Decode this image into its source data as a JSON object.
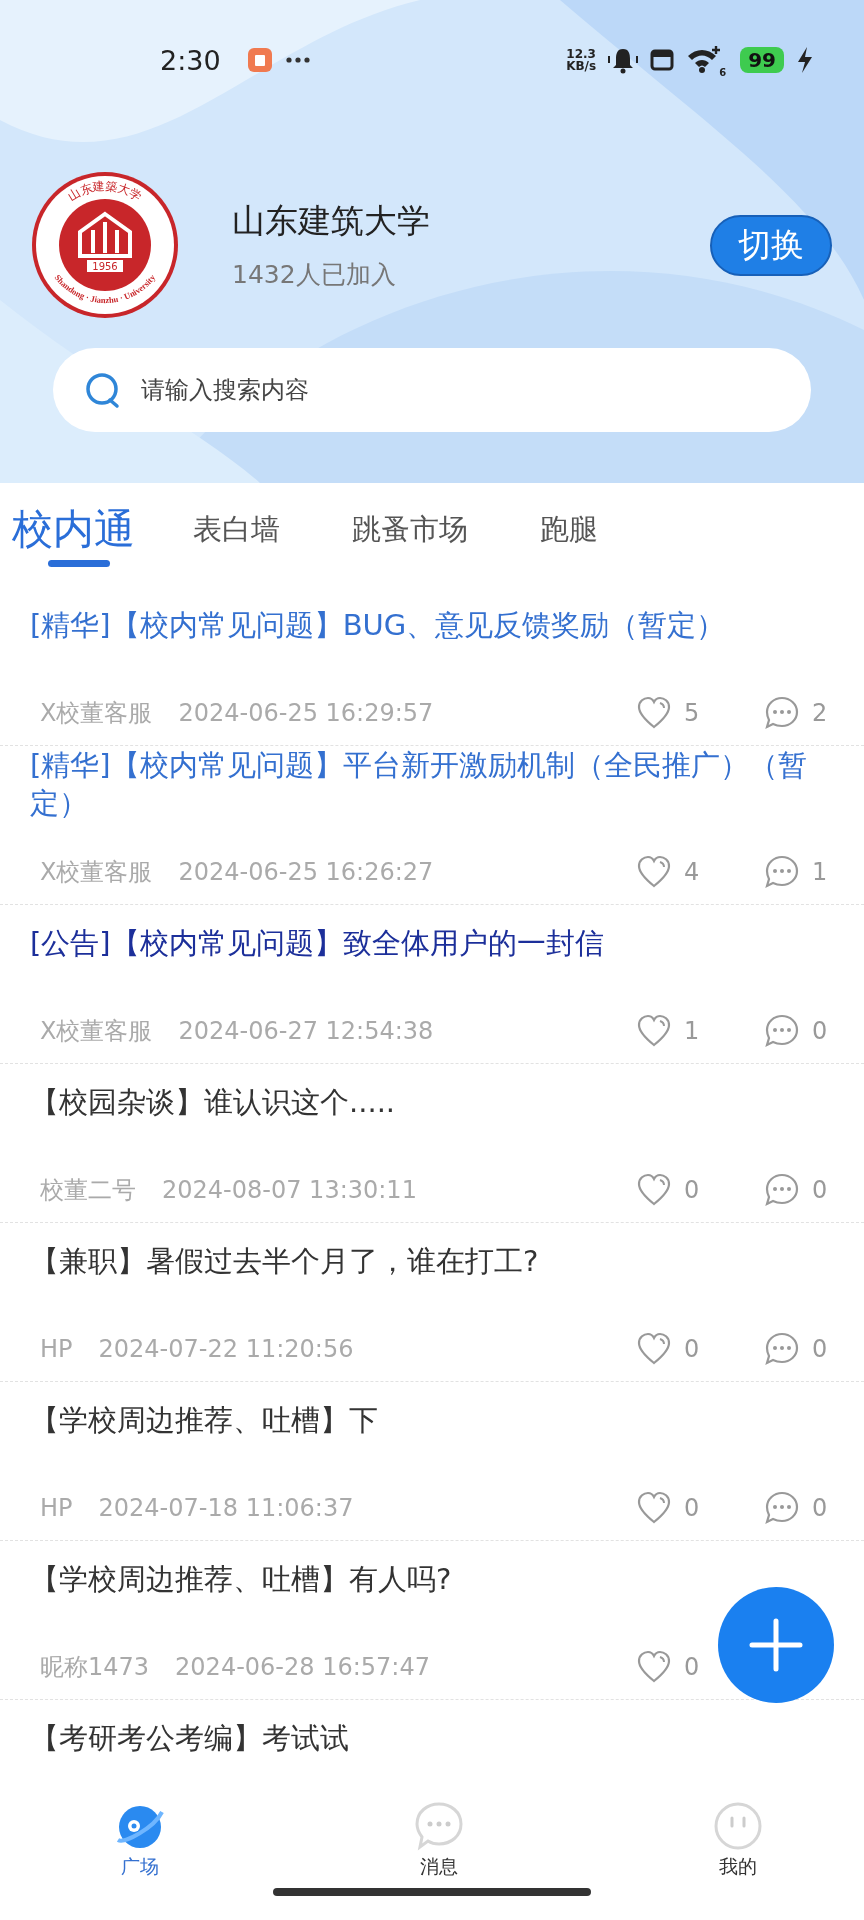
{
  "status_bar": {
    "time": "2:30",
    "net_speed_value": "12.3",
    "net_speed_unit": "KB/s",
    "wifi_badge": "6",
    "battery": "99"
  },
  "school": {
    "logo": {
      "seal_text": "山东建築大学",
      "latin_text": "Shandong · Jianzhu · University",
      "year": "1956"
    },
    "name": "山东建筑大学",
    "members": "1432人已加入",
    "switch_button": "切换"
  },
  "search": {
    "placeholder": "请输入搜索内容"
  },
  "tabs": [
    {
      "label": "校内通",
      "selected": true
    },
    {
      "label": "表白墙",
      "selected": false
    },
    {
      "label": "跳蚤市场",
      "selected": false
    },
    {
      "label": "跑腿",
      "selected": false
    }
  ],
  "posts": [
    {
      "kind": "featured",
      "title": "[精华]【校内常见问题】BUG、意见反馈奖励（暂定）",
      "author": "X校董客服",
      "time": "2024-06-25 16:29:57",
      "likes": "5",
      "comments": "2"
    },
    {
      "kind": "featured",
      "title": "[精华]【校内常见问题】平台新开激励机制（全民推广）（暂定）",
      "author": "X校董客服",
      "time": "2024-06-25 16:26:27",
      "likes": "4",
      "comments": "1"
    },
    {
      "kind": "notice",
      "title": "[公告]【校内常见问题】致全体用户的一封信",
      "author": "X校董客服",
      "time": "2024-06-27 12:54:38",
      "likes": "1",
      "comments": "0"
    },
    {
      "kind": "normal",
      "title": "【校园杂谈】谁认识这个.....",
      "author": "校董二号",
      "time": "2024-08-07 13:30:11",
      "likes": "0",
      "comments": "0"
    },
    {
      "kind": "normal",
      "title": "【兼职】暑假过去半个月了，谁在打工?",
      "author": "HP",
      "time": "2024-07-22 11:20:56",
      "likes": "0",
      "comments": "0"
    },
    {
      "kind": "normal",
      "title": "【学校周边推荐、吐槽】下",
      "author": "HP",
      "time": "2024-07-18 11:06:37",
      "likes": "0",
      "comments": "0"
    },
    {
      "kind": "normal",
      "title": "【学校周边推荐、吐槽】有人吗?",
      "author": "昵称1473",
      "time": "2024-06-28 16:57:47",
      "likes": "0"
    },
    {
      "kind": "normal",
      "title": "【考研考公考编】考试试"
    }
  ],
  "bottom_nav": [
    {
      "kind": "plaza",
      "label": "广场",
      "selected": true
    },
    {
      "kind": "message",
      "label": "消息",
      "selected": false
    },
    {
      "kind": "me",
      "label": "我的",
      "selected": false
    }
  ]
}
